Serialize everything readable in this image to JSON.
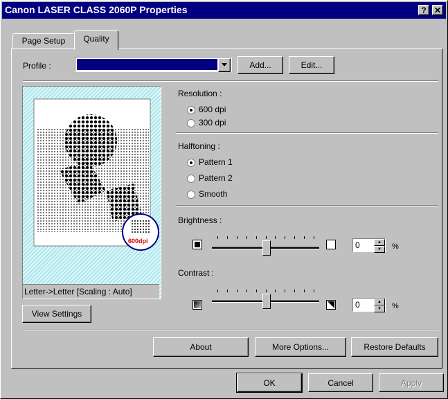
{
  "window": {
    "title": "Canon LASER CLASS 2060P Properties",
    "help_icon": "?",
    "close_icon": "✕"
  },
  "tabs": [
    {
      "label": "Page Setup"
    },
    {
      "label": "Quality"
    }
  ],
  "profile": {
    "label": "Profile :",
    "value": "",
    "add_label": "Add...",
    "edit_label": "Edit..."
  },
  "preview": {
    "badge": "600dpi",
    "caption": "Letter->Letter [Scaling : Auto]",
    "view_settings_label": "View Settings"
  },
  "resolution": {
    "label": "Resolution :",
    "options": [
      "600 dpi",
      "300 dpi"
    ],
    "selected": "600 dpi"
  },
  "halftoning": {
    "label": "Halftoning :",
    "options": [
      "Pattern 1",
      "Pattern 2",
      "Smooth"
    ],
    "selected": "Pattern 1"
  },
  "brightness": {
    "label": "Brightness :",
    "value": "0",
    "unit": "%",
    "level_fraction": 0.5
  },
  "contrast": {
    "label": "Contrast :",
    "value": "0",
    "unit": "%",
    "level_fraction": 0.5
  },
  "buttons": {
    "about": "About",
    "more_options": "More Options...",
    "restore_defaults": "Restore Defaults",
    "ok": "OK",
    "cancel": "Cancel",
    "apply": "Apply"
  },
  "colors": {
    "titlebar": "#000080",
    "face": "#c0c0c0",
    "preview_bg": "#a8e6ec",
    "badge_text": "#cc0000",
    "badge_ring": "#000080"
  }
}
